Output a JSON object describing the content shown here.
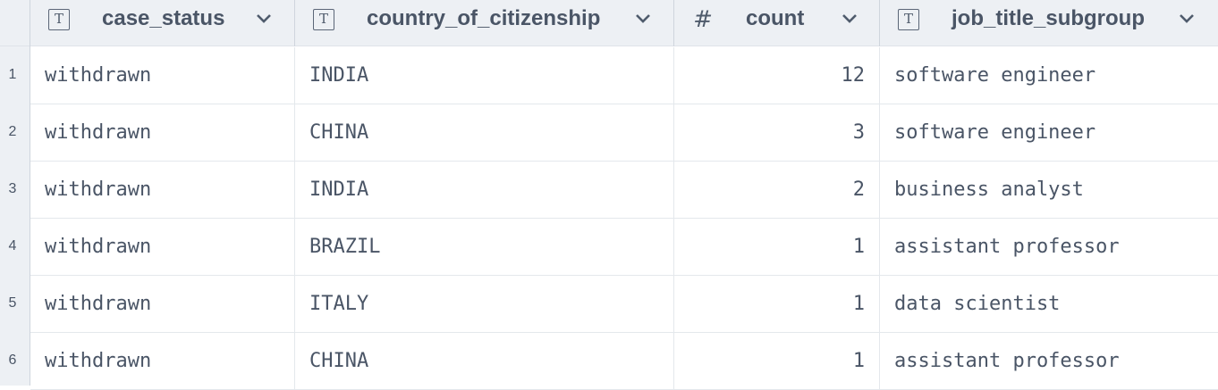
{
  "columns": [
    {
      "name": "case_status",
      "type_icon": "text-type-icon"
    },
    {
      "name": "country_of_citizenship",
      "type_icon": "text-type-icon"
    },
    {
      "name": "count",
      "type_icon": "number-type-icon"
    },
    {
      "name": "job_title_subgroup",
      "type_icon": "text-type-icon"
    }
  ],
  "icons": {
    "text_glyph": "T",
    "number_glyph": "#"
  },
  "rows": [
    {
      "num": "1",
      "case_status": "withdrawn",
      "country": "INDIA",
      "count": "12",
      "job": "software engineer"
    },
    {
      "num": "2",
      "case_status": "withdrawn",
      "country": "CHINA",
      "count": "3",
      "job": "software engineer"
    },
    {
      "num": "3",
      "case_status": "withdrawn",
      "country": "INDIA",
      "count": "2",
      "job": "business analyst"
    },
    {
      "num": "4",
      "case_status": "withdrawn",
      "country": "BRAZIL",
      "count": "1",
      "job": "assistant professor"
    },
    {
      "num": "5",
      "case_status": "withdrawn",
      "country": "ITALY",
      "count": "1",
      "job": "data scientist"
    },
    {
      "num": "6",
      "case_status": "withdrawn",
      "country": "CHINA",
      "count": "1",
      "job": "assistant professor"
    }
  ],
  "colors": {
    "header_bg": "#edf0f4",
    "text": "#4a5566",
    "grid_line": "#e4e8ec"
  }
}
